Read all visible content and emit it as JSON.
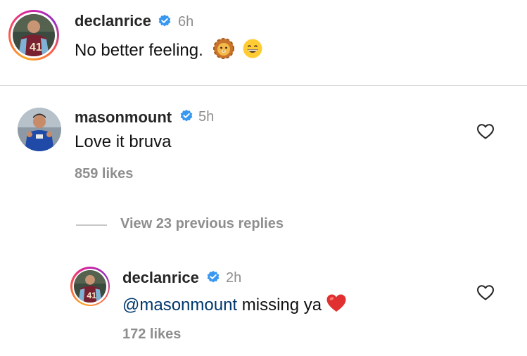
{
  "caption": {
    "username": "declanrice",
    "time": "6h",
    "text": "No better feeling.",
    "emojis": [
      "lion-face-icon",
      "grinning-face-icon"
    ]
  },
  "comment": {
    "username": "masonmount",
    "time": "5h",
    "text": "Love it bruva",
    "likes": "859 likes"
  },
  "view_replies": "View 23 previous replies",
  "reply": {
    "username": "declanrice",
    "time": "2h",
    "mention": "@masonmount",
    "text": " missing ya",
    "likes": "172 likes"
  },
  "colors": {
    "verified": "#3897f0",
    "mention": "#00376b",
    "meta_gray": "#8e8e8e",
    "heart_red": "#ed4956"
  }
}
